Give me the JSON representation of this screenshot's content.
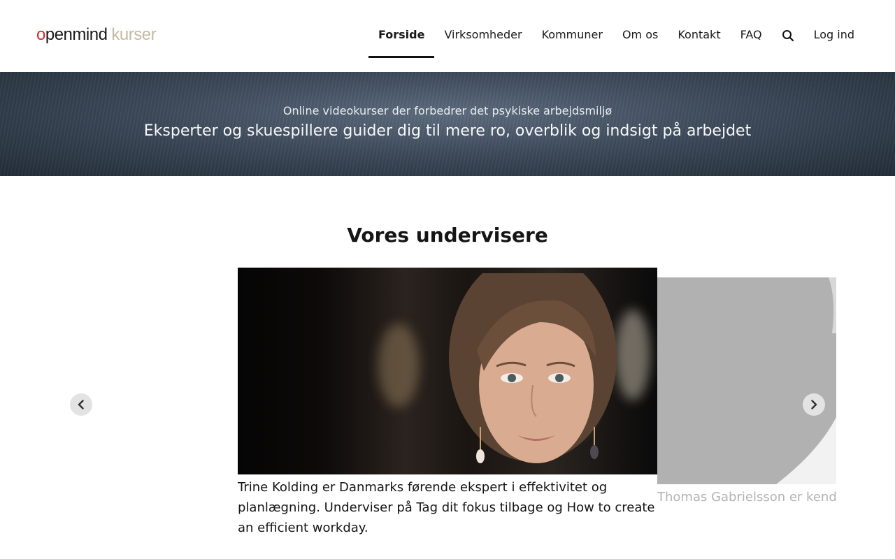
{
  "header": {
    "logo": {
      "part_o": "o",
      "part_penmind": "penmind",
      "part_kurser": "kurser"
    },
    "nav": [
      {
        "label": "Forside",
        "active": true
      },
      {
        "label": "Virksomheder",
        "active": false
      },
      {
        "label": "Kommuner",
        "active": false
      },
      {
        "label": "Om os",
        "active": false
      },
      {
        "label": "Kontakt",
        "active": false
      },
      {
        "label": "FAQ",
        "active": false
      }
    ],
    "search_icon": "search-icon",
    "login_label": "Log ind"
  },
  "hero": {
    "subtitle": "Online videokurser der forbedrer det psykiske arbejdsmiljø",
    "title": "Eksperter og skuespillere guider dig til mere ro, overblik og indsigt på arbejdet"
  },
  "instructors": {
    "heading": "Vores undervisere",
    "slides": [
      {
        "caption": "Trine Kolding er Danmarks førende ekspert i effektivitet og planlægning. Underviser på Tag dit fokus tilbage og How to create an efficient workday."
      },
      {
        "caption": "Thomas Gabrielsson er kendt fra film og tv-serier. Vært på Trou"
      }
    ],
    "prev_icon": "chevron-left-icon",
    "next_icon": "chevron-right-icon"
  },
  "colors": {
    "logo_red": "#d52b2b",
    "logo_beige": "#c6b9a2",
    "hero_bg": "#3d4a5a",
    "arrow_bg": "#e3e3e3"
  }
}
